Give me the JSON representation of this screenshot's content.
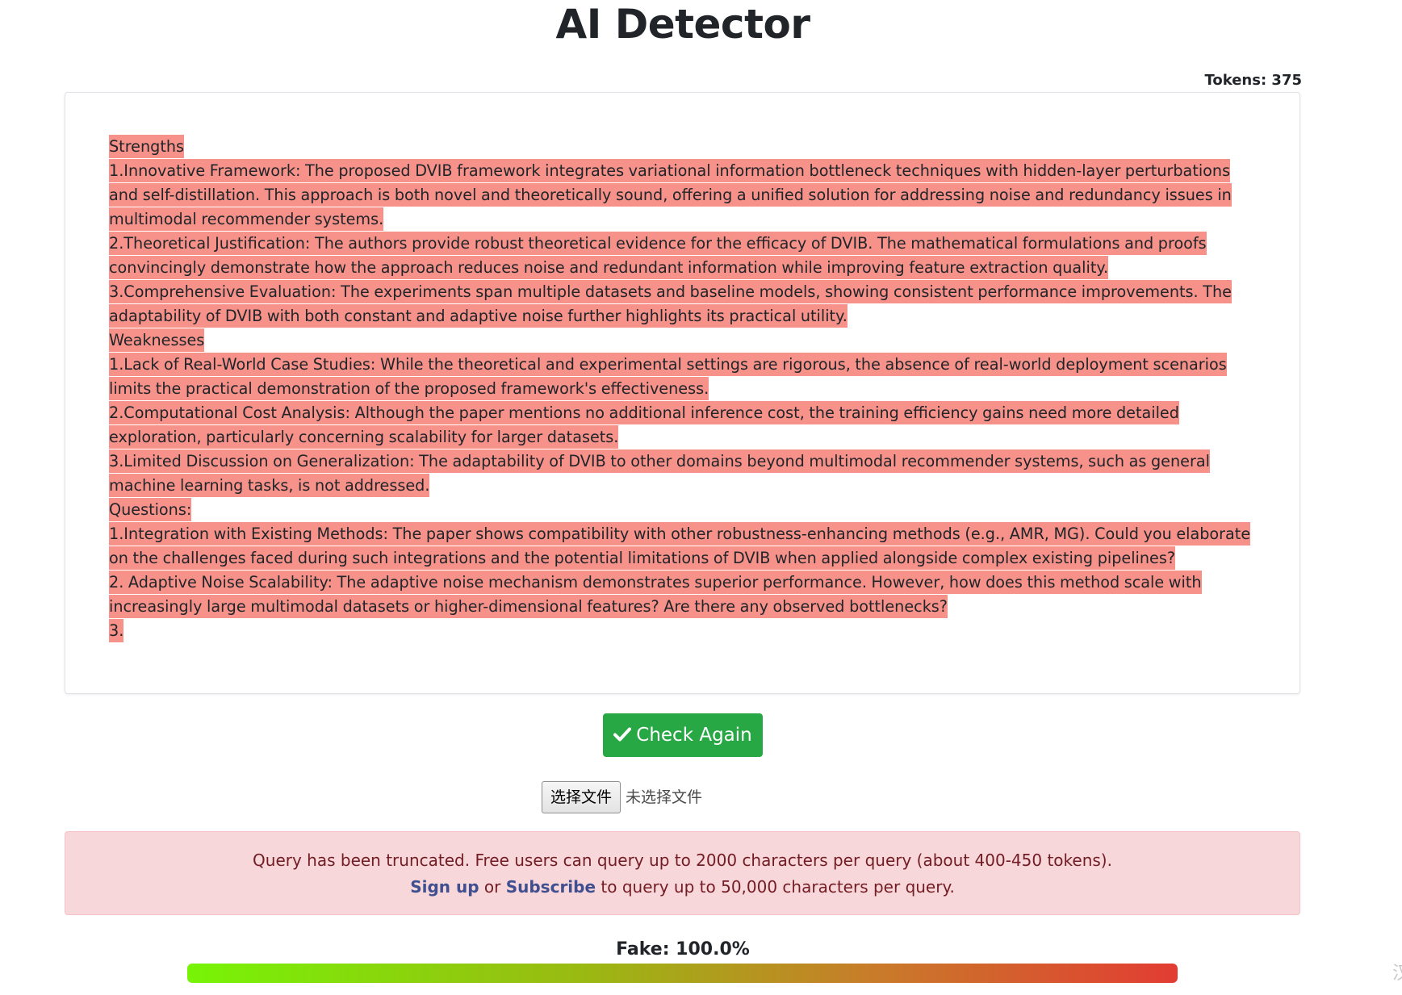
{
  "header": {
    "title": "AI Detector",
    "tokens_label": "Tokens: 375"
  },
  "content": {
    "paragraphs": [
      "Strengths",
      "1.Innovative Framework: The proposed DVIB framework integrates variational information bottleneck techniques with hidden-layer perturbations and self-distillation. This approach is both novel and theoretically sound, offering a unified solution for addressing noise and redundancy issues in multimodal recommender systems.",
      "2.Theoretical Justification: The authors provide robust theoretical evidence for the efficacy of DVIB. The mathematical formulations and proofs convincingly demonstrate how the approach reduces noise and redundant information while improving feature extraction quality.",
      "3.Comprehensive Evaluation: The experiments span multiple datasets and baseline models, showing consistent performance improvements. The adaptability of DVIB with both constant and adaptive noise further highlights its practical utility.",
      "Weaknesses",
      "1.Lack of Real-World Case Studies: While the theoretical and experimental settings are rigorous, the absence of real-world deployment scenarios limits the practical demonstration of the proposed framework's effectiveness.",
      "2.Computational Cost Analysis: Although the paper mentions no additional inference cost, the training efficiency gains need more detailed exploration, particularly concerning scalability for larger datasets.",
      "3.Limited Discussion on Generalization: The adaptability of DVIB to other domains beyond multimodal recommender systems, such as general machine learning tasks, is not addressed.",
      "Questions:",
      "1.Integration with Existing Methods: The paper shows compatibility with other robustness-enhancing methods (e.g., AMR, MG). Could you elaborate on the challenges faced during such integrations and the potential limitations of DVIB when applied alongside complex existing pipelines?",
      "2. Adaptive Noise Scalability: The adaptive noise mechanism demonstrates superior performance. However, how does this method scale with increasingly large multimodal datasets or higher-dimensional features? Are there any observed bottlenecks?",
      "3."
    ],
    "highlight_color": "#f7928a"
  },
  "actions": {
    "check_again_label": "Check Again",
    "check_icon": "check-icon",
    "button_color": "#28a745"
  },
  "file_input": {
    "button_label": "选择文件",
    "status_text": "未选择文件"
  },
  "alert": {
    "line1": "Query has been truncated. Free users can query up to 2000 characters per query (about 400-450 tokens).",
    "signup_link": "Sign up",
    "or_text": "or",
    "subscribe_link": "Subscribe",
    "line2_suffix": "to query up to 50,000 characters per query."
  },
  "result": {
    "fake_label": "Fake: 100.0%",
    "fake_fraction": 1.0
  },
  "corner": {
    "glyph": "汉"
  }
}
